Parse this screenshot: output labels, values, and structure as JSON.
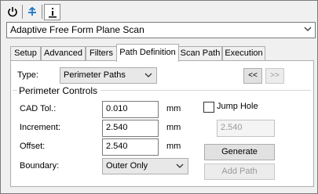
{
  "toolbar": {
    "power_icon": "power-icon",
    "pin_icon": "pin-icon",
    "info_icon": "info-icon"
  },
  "strategy": {
    "selected": "Adaptive Free Form Plane Scan"
  },
  "tabs": [
    {
      "label": "Setup"
    },
    {
      "label": "Advanced"
    },
    {
      "label": "Filters"
    },
    {
      "label": "Path Definition"
    },
    {
      "label": "Scan Path"
    },
    {
      "label": "Execution"
    }
  ],
  "active_tab": "Path Definition",
  "path_definition": {
    "type_label": "Type:",
    "type_value": "Perimeter Paths",
    "prev_label": "<<",
    "next_label": ">>",
    "group_title": "Perimeter Controls",
    "cad_tol_label": "CAD Tol.:",
    "cad_tol_value": "0.010",
    "cad_tol_unit": "mm",
    "increment_label": "Increment:",
    "increment_value": "2.540",
    "increment_unit": "mm",
    "offset_label": "Offset:",
    "offset_value": "2.540",
    "offset_unit": "mm",
    "boundary_label": "Boundary:",
    "boundary_value": "Outer Only",
    "jump_hole_label": "Jump Hole",
    "jump_hole_checked": false,
    "jump_hole_value": "2.540",
    "generate_label": "Generate",
    "add_path_label": "Add Path"
  }
}
